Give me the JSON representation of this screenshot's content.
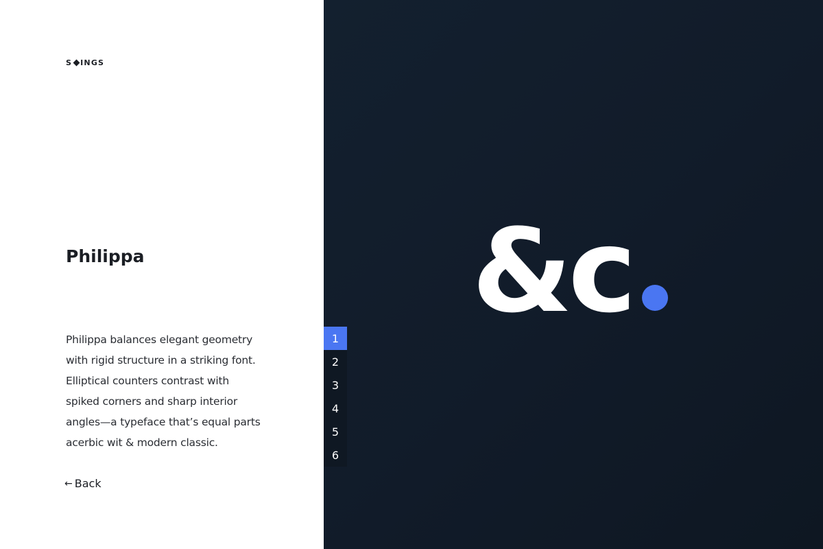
{
  "brand": {
    "logo_left": "S",
    "logo_right": "INGS"
  },
  "font": {
    "name": "Philippa",
    "description": "Philippa balances elegant geometry with rigid structure in a striking font. Elliptical counters contrast with spiked corners and sharp interior angles—a typeface that’s equal parts acerbic wit & modern classic."
  },
  "navigation": {
    "back_arrow": "←",
    "back_label": "Back"
  },
  "specimen": {
    "glyphs": "&c",
    "dot_color": "#4a76f2",
    "background_color": "#111b29"
  },
  "pager": {
    "active_index": 0,
    "accent_color": "#4a76f2",
    "items": [
      "1",
      "2",
      "3",
      "4",
      "5",
      "6"
    ]
  }
}
